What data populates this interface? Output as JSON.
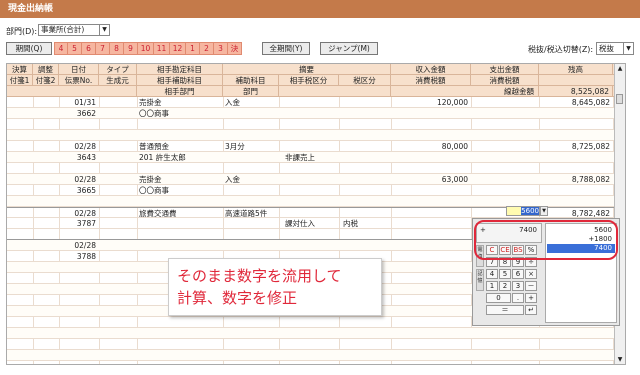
{
  "window_title": "現金出納帳",
  "dept_label": "部門(D):",
  "dept_value": "事業所(合計)",
  "period_button": "期間(Q)",
  "months": [
    "4",
    "5",
    "6",
    "7",
    "8",
    "9",
    "10",
    "11",
    "12",
    "1",
    "2",
    "3",
    "決"
  ],
  "full_period_button": "全期間(Y)",
  "jump_button": "ジャンプ(M)",
  "tax_label": "税抜/税込切替(Z):",
  "tax_value": "税抜",
  "header_row1": [
    "決算",
    "調整",
    "日付",
    "タイプ",
    "相手勘定科目",
    "摘要",
    "",
    "収入金額",
    "支出金額",
    "残高"
  ],
  "header_row2": [
    "付箋1",
    "付箋2",
    "伝票No.",
    "生成元",
    "相手補助科目",
    "補助科目",
    "相手税区分",
    "税区分",
    "消費税額",
    "消費税額"
  ],
  "header_row3": [
    "相手部門",
    "部門",
    "線越金額"
  ],
  "entries": [
    {
      "date": "01/31",
      "no": "3662",
      "account": "売掛金",
      "sub": "〇〇商事",
      "summary": "入金",
      "tax": "",
      "income": "120,000",
      "expense": "",
      "balance": "8,645,082"
    },
    {
      "date": "02/28",
      "no": "3643",
      "account": "普通預金",
      "sub": "201 許生太郎",
      "summary": "3月分",
      "tax": "非課売上",
      "income": "80,000",
      "expense": "",
      "balance": "8,725,082"
    },
    {
      "date": "02/28",
      "no": "3665",
      "account": "売掛金",
      "sub": "〇〇商事",
      "summary": "入金",
      "tax": "",
      "income": "63,000",
      "expense": "",
      "balance": "8,788,082"
    },
    {
      "date": "02/28",
      "no": "3787",
      "account": "旅費交通費",
      "sub": "",
      "summary": "高速道路5件",
      "tax": "課対仕入",
      "tax2": "内税",
      "income": "",
      "expense": "5600",
      "balance": "8,782,482"
    },
    {
      "date": "02/28",
      "no": "3788",
      "account": "",
      "sub": "",
      "summary": "",
      "tax": "",
      "income": "",
      "expense": "",
      "balance": ""
    }
  ],
  "carryover_balance": "8,525,082",
  "calculator": {
    "display_op": "+",
    "display_value": "7400",
    "tape_line1": "5600",
    "tape_line2": "+1800",
    "tape_result": "7400",
    "keys": [
      "C",
      "CE",
      "BS",
      "%",
      "7",
      "8",
      "9",
      "÷",
      "4",
      "5",
      "6",
      "×",
      "1",
      "2",
      "3",
      "－",
      "0",
      ".",
      "+",
      "＝",
      "↵"
    ],
    "side_tabs": [
      "電卓",
      "記憶"
    ]
  },
  "annotation": [
    "そのまま数字を流用して",
    "計算、数字を修正"
  ]
}
